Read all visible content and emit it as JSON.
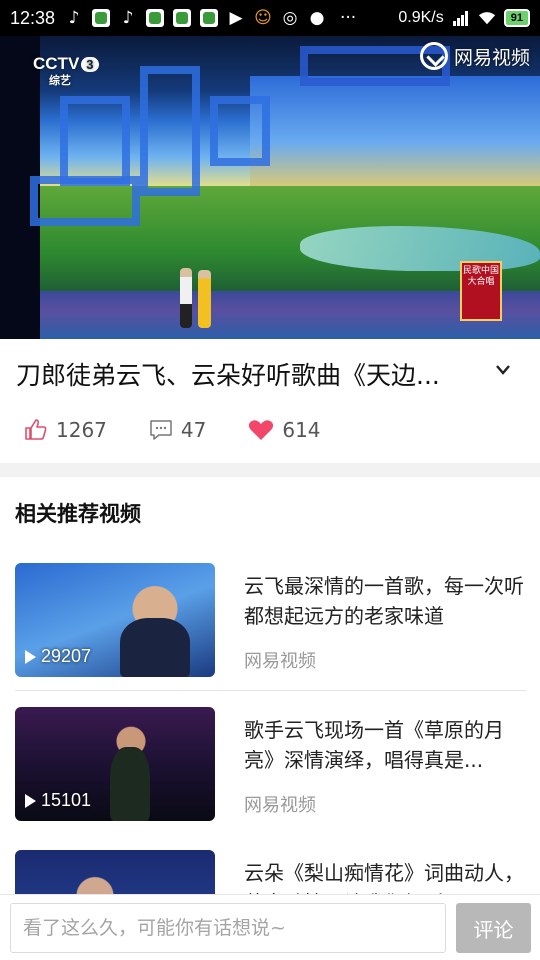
{
  "status_bar": {
    "time": "12:38",
    "net_speed": "0.9K/s",
    "battery": "91",
    "icons": [
      "tiktok-icon",
      "wechat-icon",
      "tiktok-icon",
      "wechat-icon",
      "wechat-icon",
      "wechat-icon",
      "video-icon",
      "face-icon",
      "netease-icon",
      "chat-bubble-icon",
      "more-icon",
      "signal-icon",
      "wifi-icon",
      "battery-icon"
    ]
  },
  "video": {
    "channel_logo": "CCTV",
    "channel_number": "3",
    "channel_sub": "综艺",
    "watermark": "网易视频",
    "show_badge": "民歌中国大合唱"
  },
  "title": {
    "text": "刀郎徒弟云飞、云朵好听歌曲《天边..."
  },
  "stats": {
    "likes": "1267",
    "comments": "47",
    "favorites": "614"
  },
  "section": {
    "title": "相关推荐视频"
  },
  "recommendations": [
    {
      "title": "云飞最深情的一首歌，每一次听都想起远方的老家味道",
      "play_count": "29207",
      "source": "网易视频"
    },
    {
      "title": "歌手云飞现场一首《草原的月亮》深情演绎，唱得真是...",
      "play_count": "15101",
      "source": "网易视频"
    },
    {
      "title": "云朵《梨山痴情花》词曲动人，蒙音动情，让我们倾听",
      "play_count": "",
      "source": ""
    }
  ],
  "comment_bar": {
    "placeholder": "看了这么久，可能你有话想说~",
    "button_label": "评论"
  },
  "colors": {
    "heart": "#f0476a",
    "muted_text": "#999999",
    "button_bg": "#b8b8b8"
  }
}
